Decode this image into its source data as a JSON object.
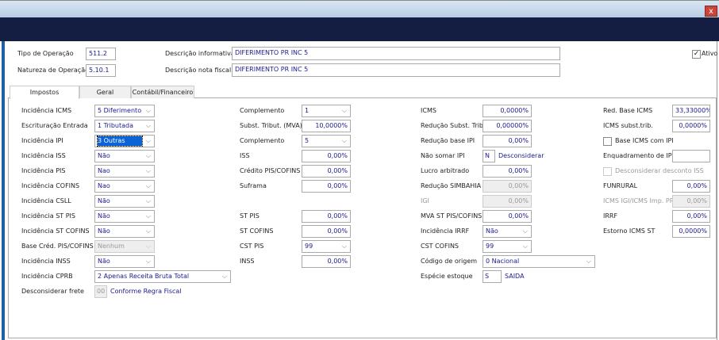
{
  "window": {
    "close_label": "x"
  },
  "header": {
    "tipo_operacao": {
      "label": "Tipo de Operação",
      "value": "511.2"
    },
    "natureza_operacao": {
      "label": "Natureza de Operação",
      "value": "5.10.1"
    },
    "descricao_informativa": {
      "label": "Descrição informativa",
      "value": "DIFERIMENTO PR INC 5"
    },
    "descricao_nota_fiscal": {
      "label": "Descrição nota fiscal",
      "value": "DIFERIMENTO PR INC 5"
    },
    "ativo": {
      "label": "Ativo",
      "checked": true
    }
  },
  "tabs": [
    {
      "label": "Impostos",
      "active": true
    },
    {
      "label": "Geral",
      "active": false
    },
    {
      "label": "Contábil/Financeiro",
      "active": false
    }
  ],
  "columns": [
    [
      {
        "label": "Incidência ICMS",
        "type": "select",
        "value": "5 Diferimento"
      },
      {
        "label": "Escrituração Entrada",
        "type": "select",
        "value": "1 Tributada"
      },
      {
        "label": "Incidência IPI",
        "type": "select",
        "value": "3 Outras",
        "focused": true
      },
      {
        "label": "Incidência ISS",
        "type": "select",
        "value": "Não"
      },
      {
        "label": "Incidência PIS",
        "type": "select",
        "value": "Nao"
      },
      {
        "label": "Incidência COFINS",
        "type": "select",
        "value": "Nao"
      },
      {
        "label": "Incidência CSLL",
        "type": "select",
        "value": "Não"
      },
      {
        "label": "Incidência ST PIS",
        "type": "select",
        "value": "Não"
      },
      {
        "label": "Incidência ST COFINS",
        "type": "select",
        "value": "Não"
      },
      {
        "label": "Base Créd. PIS/COFINS",
        "type": "select",
        "value": "Nenhum",
        "disabled": true
      },
      {
        "label": "Incidência INSS",
        "type": "select",
        "value": "Não"
      },
      {
        "label": "Incidência CPRB",
        "type": "select",
        "value": "2 Apenas Receita Bruta Total",
        "wide": true
      },
      {
        "label": "Desconsiderar frete",
        "type": "code",
        "value": "00",
        "disabled": true,
        "desc": "Conforme Regra Fiscal"
      }
    ],
    [
      {
        "label": "Complemento",
        "type": "select",
        "value": "1"
      },
      {
        "label": "Subst. Tribut. (MVA)",
        "type": "input",
        "value": "10,0000%"
      },
      {
        "label": "Complemento",
        "type": "select",
        "value": "5"
      },
      {
        "label": "ISS",
        "type": "input",
        "value": "0,00%"
      },
      {
        "label": "Crédito PIS/COFINS",
        "type": "input",
        "value": "0,00%"
      },
      {
        "label": "Suframa",
        "type": "input",
        "value": "0,00%"
      },
      null,
      {
        "label": "ST PIS",
        "type": "input",
        "value": "0,00%"
      },
      {
        "label": "ST COFINS",
        "type": "input",
        "value": "0,00%"
      },
      {
        "label": "CST PIS",
        "type": "select",
        "value": "99"
      },
      {
        "label": "INSS",
        "type": "input",
        "value": "0,00%"
      }
    ],
    [
      {
        "label": "ICMS",
        "type": "input",
        "value": "0,0000%"
      },
      {
        "label": "Redução Subst. Trib.",
        "type": "input",
        "value": "0,00000%"
      },
      {
        "label": "Redução base IPI",
        "type": "input",
        "value": "0,00%"
      },
      {
        "label": "Não somar IPI",
        "type": "code",
        "value": "N",
        "desc": "Desconsiderar"
      },
      {
        "label": "Lucro arbitrado",
        "type": "input",
        "value": "0,00%"
      },
      {
        "label": "Redução SIMBAHIA",
        "type": "input",
        "value": "0,00%",
        "disabled": true
      },
      {
        "label": "IGI",
        "type": "input",
        "value": "0,00%",
        "disabled": true,
        "grey_label": true
      },
      {
        "label": "MVA ST PIS/COFINS",
        "type": "input",
        "value": "0,00%"
      },
      {
        "label": "Incidência IRRF",
        "type": "select",
        "value": "Não"
      },
      {
        "label": "CST COFINS",
        "type": "select",
        "value": "99"
      },
      {
        "label": "Código de origem",
        "type": "select",
        "value": "0 Nacional",
        "wide": true
      },
      {
        "label": "Espécie estoque",
        "type": "code",
        "value": "S",
        "desc": "SAIDA",
        "codewide": true
      }
    ],
    [
      {
        "label": "Red. Base ICMS",
        "type": "input",
        "value": "33,33000%"
      },
      {
        "label": "ICMS subst.trib.",
        "type": "input",
        "value": "0,0000%"
      },
      {
        "label": "Base ICMS com IPI",
        "type": "checkbox",
        "checked": false
      },
      {
        "label": "Enquadramento de IPI",
        "type": "input",
        "value": ""
      },
      {
        "label": "Desconsiderar desconto ISS",
        "type": "checkbox",
        "checked": false,
        "disabled": true
      },
      {
        "label": "FUNRURAL",
        "type": "input",
        "value": "0,00%"
      },
      {
        "label": "ICMS IGI/ICMS Imp. PR",
        "type": "input",
        "value": "0,00%",
        "disabled": true,
        "grey_label": true
      },
      {
        "label": "IRRF",
        "type": "input",
        "value": "0,00%"
      },
      {
        "label": "Estorno ICMS ST",
        "type": "input",
        "value": "0,0000%"
      }
    ]
  ],
  "colors": {
    "navy": "#141e42",
    "accent": "#1f5fa8",
    "value_text": "#1a1a8c",
    "focus": "#0a64d8"
  }
}
